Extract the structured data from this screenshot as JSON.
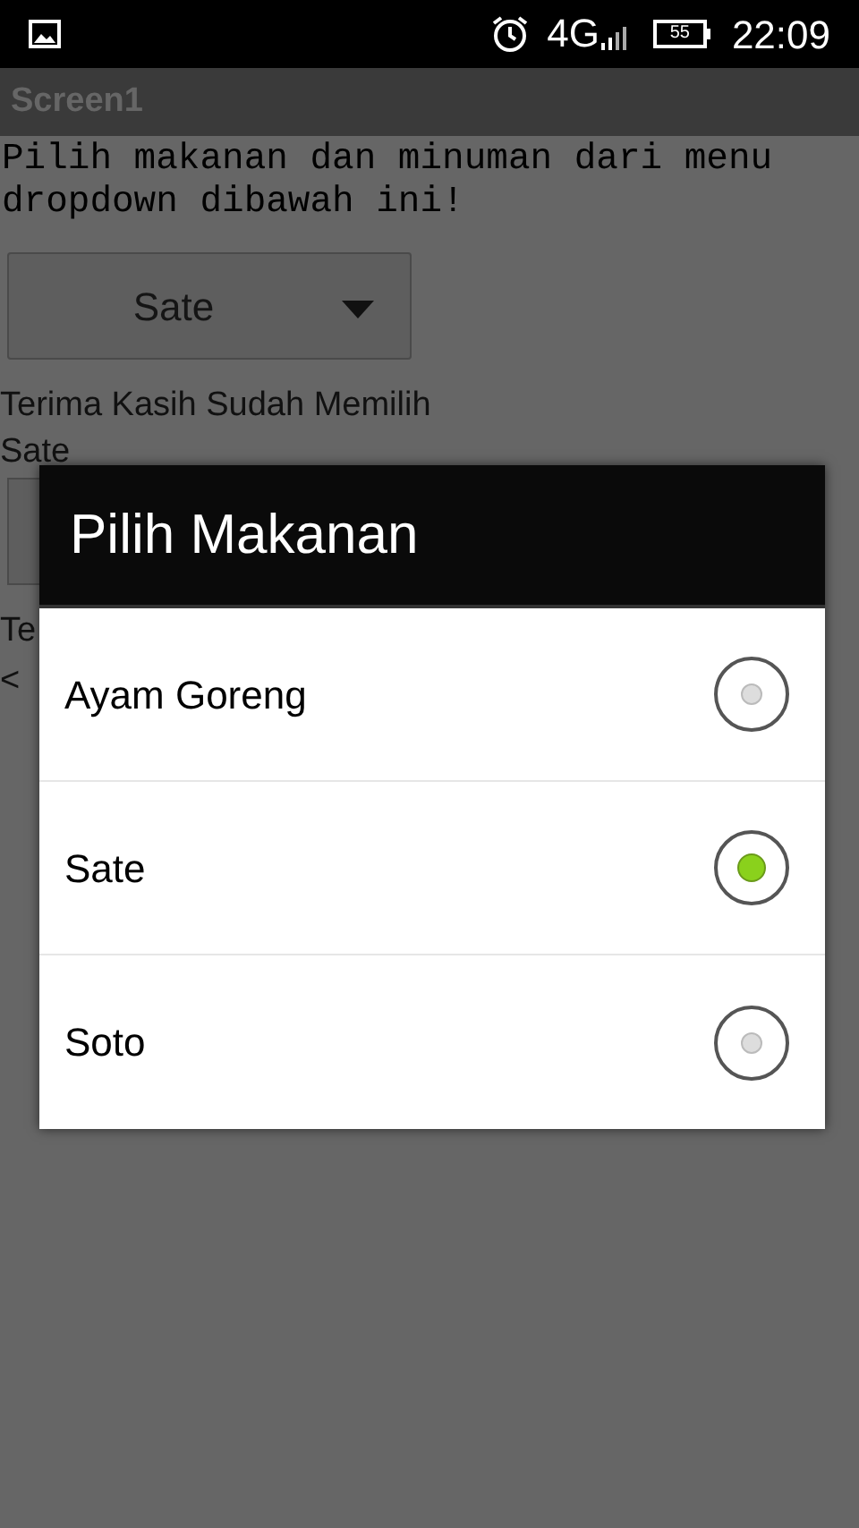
{
  "status_bar": {
    "network": "4G",
    "battery": "55",
    "time": "22:09"
  },
  "title_bar": {
    "title": "Screen1"
  },
  "instruction": "Pilih makanan dan minuman dari menu dropdown dibawah ini!",
  "spinner": {
    "value": "Sate"
  },
  "thanks_label": "Terima Kasih Sudah Memilih",
  "food_result": "Sate",
  "drink_label": "Te",
  "drink_result": "<",
  "dialog": {
    "title": "Pilih Makanan",
    "options": [
      {
        "label": "Ayam Goreng",
        "selected": false
      },
      {
        "label": "Sate",
        "selected": true
      },
      {
        "label": "Soto",
        "selected": false
      }
    ]
  }
}
